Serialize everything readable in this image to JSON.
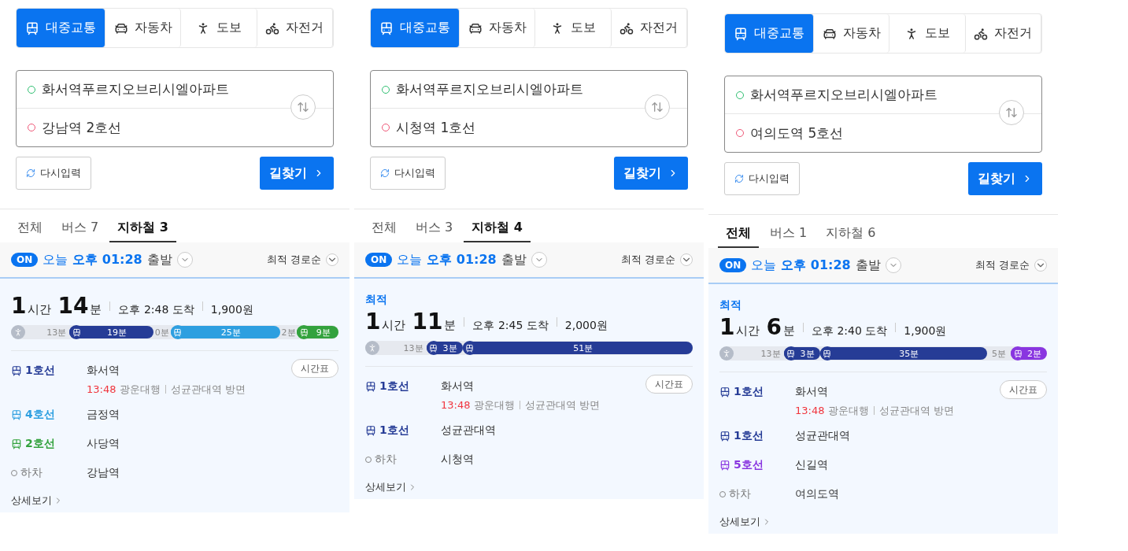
{
  "panels": [
    {
      "modes": [
        {
          "kind": "transit",
          "label": "대중교통",
          "selected": true
        },
        {
          "kind": "car",
          "label": "자동차",
          "selected": false
        },
        {
          "kind": "walk",
          "label": "도보",
          "selected": false
        },
        {
          "kind": "bike",
          "label": "자전거",
          "selected": false
        }
      ],
      "origin": "화서역푸르지오브리시엘아파트",
      "destination": "강남역 2호선",
      "reset": "다시입력",
      "search": "길찾기",
      "filters": [
        {
          "label": "전체",
          "selected": false
        },
        {
          "label": "버스 7",
          "selected": false
        },
        {
          "label": "지하철 3",
          "selected": true
        }
      ],
      "departure": {
        "on": "ON",
        "day": "오늘",
        "time": "오후 01:28",
        "suffix": "출발"
      },
      "sort": "최적 경로순",
      "route": {
        "hours": "1",
        "hours_unit": "시간",
        "minutes": "14",
        "minutes_unit": "분",
        "arrival": "오후 2:48 도착",
        "fare": "1,900원",
        "segments": [
          {
            "kind": "walk",
            "label": "13분"
          },
          {
            "kind": "subway",
            "label": "19분",
            "color": "#263c96"
          },
          {
            "kind": "transfer",
            "label": "0분"
          },
          {
            "kind": "subway",
            "label": "25분",
            "color": "#2e9fe0"
          },
          {
            "kind": "transfer",
            "label": "2분"
          },
          {
            "kind": "subway",
            "label": "9분",
            "color": "#33a23d"
          }
        ],
        "steps": [
          {
            "kind": "subway",
            "line": "1호선",
            "color": "#263c96",
            "station": "화서역",
            "timetable": "시간표",
            "time": "13:48",
            "direction": "광운대행",
            "toward": "성균관대역 방면"
          },
          {
            "kind": "subway",
            "line": "4호선",
            "color": "#2e9fe0",
            "station": "금정역"
          },
          {
            "kind": "subway",
            "line": "2호선",
            "color": "#33a23d",
            "station": "사당역"
          },
          {
            "kind": "exit",
            "line": "하차",
            "station": "강남역"
          }
        ],
        "more": "상세보기"
      }
    },
    {
      "modes": [
        {
          "kind": "transit",
          "label": "대중교통",
          "selected": true
        },
        {
          "kind": "car",
          "label": "자동차",
          "selected": false
        },
        {
          "kind": "walk",
          "label": "도보",
          "selected": false
        },
        {
          "kind": "bike",
          "label": "자전거",
          "selected": false
        }
      ],
      "origin": "화서역푸르지오브리시엘아파트",
      "destination": "시청역 1호선",
      "reset": "다시입력",
      "search": "길찾기",
      "filters": [
        {
          "label": "전체",
          "selected": false
        },
        {
          "label": "버스 3",
          "selected": false
        },
        {
          "label": "지하철 4",
          "selected": true
        }
      ],
      "departure": {
        "on": "ON",
        "day": "오늘",
        "time": "오후 01:28",
        "suffix": "출발"
      },
      "sort": "최적 경로순",
      "route": {
        "badge": "최적",
        "hours": "1",
        "hours_unit": "시간",
        "minutes": "11",
        "minutes_unit": "분",
        "arrival": "오후 2:45 도착",
        "fare": "2,000원",
        "segments": [
          {
            "kind": "walk",
            "label": "13분"
          },
          {
            "kind": "subway",
            "label": "3분",
            "color": "#263c96"
          },
          {
            "kind": "subway",
            "label": "51분",
            "color": "#263c96"
          }
        ],
        "steps": [
          {
            "kind": "subway",
            "line": "1호선",
            "color": "#263c96",
            "station": "화서역",
            "timetable": "시간표",
            "time": "13:48",
            "direction": "광운대행",
            "toward": "성균관대역 방면"
          },
          {
            "kind": "subway",
            "line": "1호선",
            "color": "#263c96",
            "station": "성균관대역"
          },
          {
            "kind": "exit",
            "line": "하차",
            "station": "시청역"
          }
        ],
        "more": "상세보기"
      }
    },
    {
      "modes": [
        {
          "kind": "transit",
          "label": "대중교통",
          "selected": true
        },
        {
          "kind": "car",
          "label": "자동차",
          "selected": false
        },
        {
          "kind": "walk",
          "label": "도보",
          "selected": false
        },
        {
          "kind": "bike",
          "label": "자전거",
          "selected": false
        }
      ],
      "origin": "화서역푸르지오브리시엘아파트",
      "destination": "여의도역 5호선",
      "reset": "다시입력",
      "search": "길찾기",
      "filters": [
        {
          "label": "전체",
          "selected": true
        },
        {
          "label": "버스 1",
          "selected": false
        },
        {
          "label": "지하철 6",
          "selected": false
        }
      ],
      "departure": {
        "on": "ON",
        "day": "오늘",
        "time": "오후 01:28",
        "suffix": "출발"
      },
      "sort": "최적 경로순",
      "route": {
        "badge": "최적",
        "hours": "1",
        "hours_unit": "시간",
        "minutes": "6",
        "minutes_unit": "분",
        "arrival": "오후 2:40 도착",
        "fare": "1,900원",
        "segments": [
          {
            "kind": "walk",
            "label": "13분"
          },
          {
            "kind": "subway",
            "label": "3분",
            "color": "#263c96"
          },
          {
            "kind": "subway",
            "label": "35분",
            "color": "#263c96"
          },
          {
            "kind": "transfer",
            "label": "5분"
          },
          {
            "kind": "subway",
            "label": "2분",
            "color": "#8936e0"
          }
        ],
        "steps": [
          {
            "kind": "subway",
            "line": "1호선",
            "color": "#263c96",
            "station": "화서역",
            "timetable": "시간표",
            "time": "13:48",
            "direction": "광운대행",
            "toward": "성균관대역 방면"
          },
          {
            "kind": "subway",
            "line": "1호선",
            "color": "#263c96",
            "station": "성균관대역"
          },
          {
            "kind": "subway",
            "line": "5호선",
            "color": "#8936e0",
            "station": "신길역"
          },
          {
            "kind": "exit",
            "line": "하차",
            "station": "여의도역"
          }
        ],
        "more": "상세보기"
      }
    }
  ]
}
